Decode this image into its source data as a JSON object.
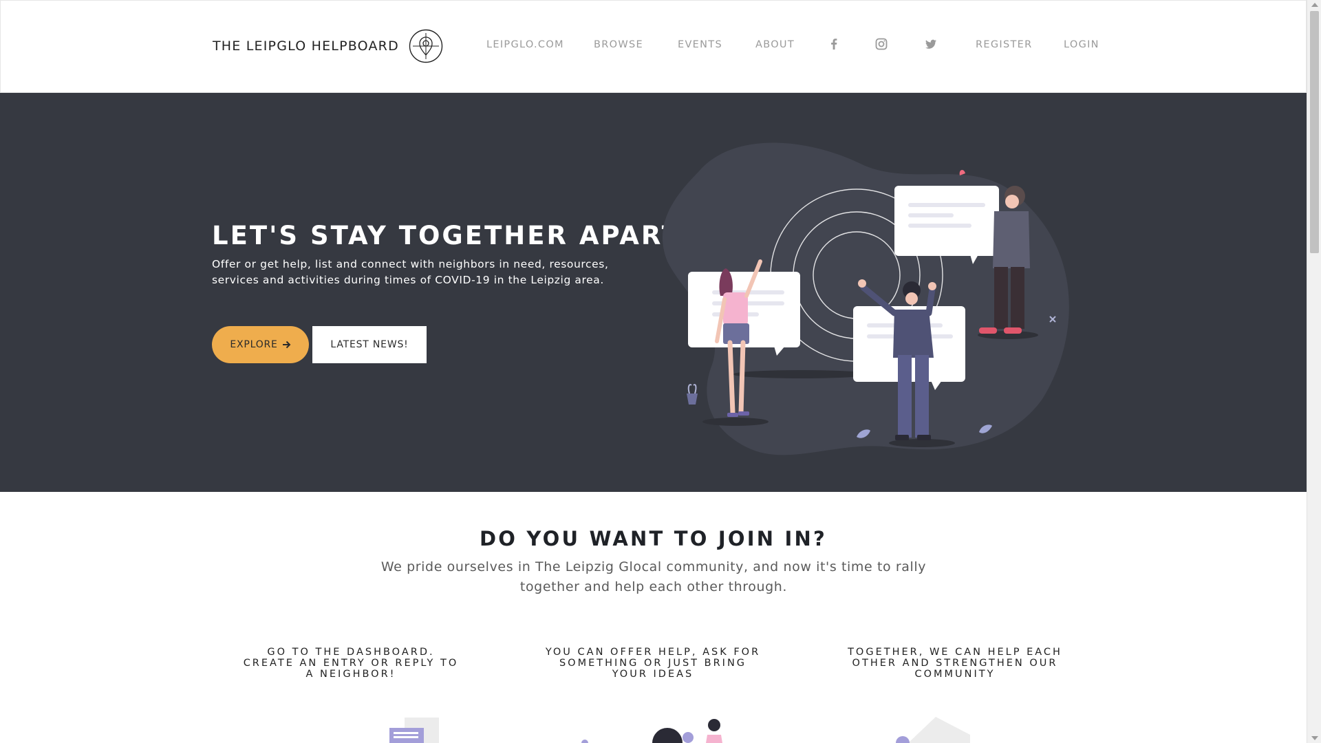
{
  "header": {
    "brand": "THE LEIPGLO HELPBOARD",
    "logo_icon": "location-pin-target-icon",
    "nav": [
      {
        "label": "LEIPGLO.COM"
      },
      {
        "label": "BROWSE"
      },
      {
        "label": "EVENTS"
      },
      {
        "label": "ABOUT"
      }
    ],
    "social_icons": [
      "facebook-icon",
      "instagram-icon",
      "twitter-icon"
    ],
    "register_label": "REGISTER",
    "login_label": "LOGIN"
  },
  "hero": {
    "title": "LET'S STAY TOGETHER APART",
    "subtitle": "Offer or get help, list and connect with neighbors in need, resources, services and activities during times of COVID-19 in the Leipzig area.",
    "explore_label": "EXPLORE",
    "explore_icon": "arrow-right-icon",
    "news_label": "LATEST NEWS!"
  },
  "join": {
    "title": "DO YOU WANT TO JOIN IN?",
    "subtitle": "We pride ourselves in The Leipzig Glocal community, and now it's time to rally together and help each other through.",
    "steps": [
      {
        "text": "GO TO THE DASHBOARD. CREATE AN ENTRY OR REPLY TO A NEIGHBOR!"
      },
      {
        "text": "YOU CAN OFFER HELP, ASK FOR SOMETHING OR JUST BRING YOUR IDEAS"
      },
      {
        "text": "TOGETHER, WE CAN HELP EACH OTHER AND STRENGTHEN OUR COMMUNITY"
      }
    ]
  },
  "colors": {
    "hero_bg": "#363941",
    "accent": "#efad4d",
    "nav_text": "#9a9a9a",
    "illustration_purple": "#6c63a8"
  }
}
